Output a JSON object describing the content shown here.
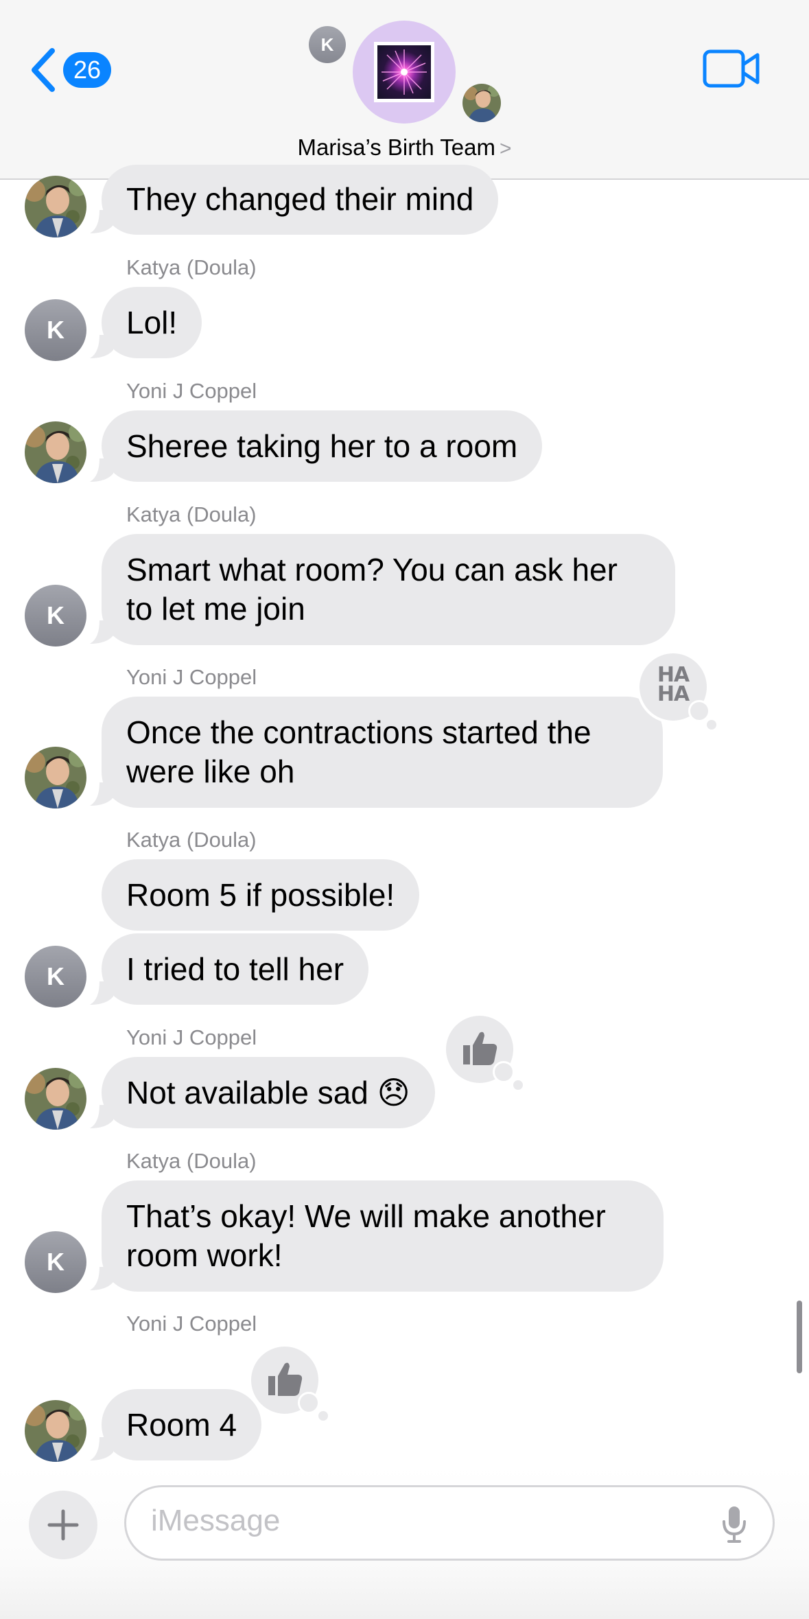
{
  "header": {
    "back_count": "26",
    "group_name": "Marisa’s Birth Team",
    "name_chevron": ">",
    "member_initial": "K",
    "icons": {
      "back": "chevron-left-icon",
      "video": "video-camera-icon"
    },
    "accent_color": "#0a84ff"
  },
  "messages": [
    {
      "sender": "",
      "text": "They changed their mind",
      "from": "Yoni J Coppel"
    },
    {
      "sender": "Katya (Doula)",
      "text": "Lol!",
      "avatar": "K"
    },
    {
      "sender": "Yoni J Coppel",
      "text": "Sheree taking her to a room"
    },
    {
      "sender": "Katya (Doula)",
      "text": "Smart what room? You can ask her\nto let me join",
      "avatar": "K"
    },
    {
      "sender": "Yoni J Coppel",
      "text": "Once the contractions started the\nwere like oh",
      "reaction": "haha"
    },
    {
      "sender": "Katya (Doula)",
      "text": "Room 5 if possible!"
    },
    {
      "sender": "",
      "text": "I tried to tell her",
      "avatar": "K"
    },
    {
      "sender": "Yoni J Coppel",
      "text": "Not available sad 😞",
      "reaction": "thumbs-up"
    },
    {
      "sender": "Katya (Doula)",
      "text": "That’s okay! We will make another\nroom work!",
      "avatar": "K"
    },
    {
      "sender": "Yoni J Coppel",
      "text": "Room 4",
      "reaction": "thumbs-up"
    }
  ],
  "reactions": {
    "haha_line1": "HA",
    "haha_line2": "HA"
  },
  "input": {
    "placeholder": "iMessage",
    "icons": {
      "plus": "plus-icon",
      "mic": "microphone-icon"
    }
  },
  "bubble_color": "#e9e9eb"
}
